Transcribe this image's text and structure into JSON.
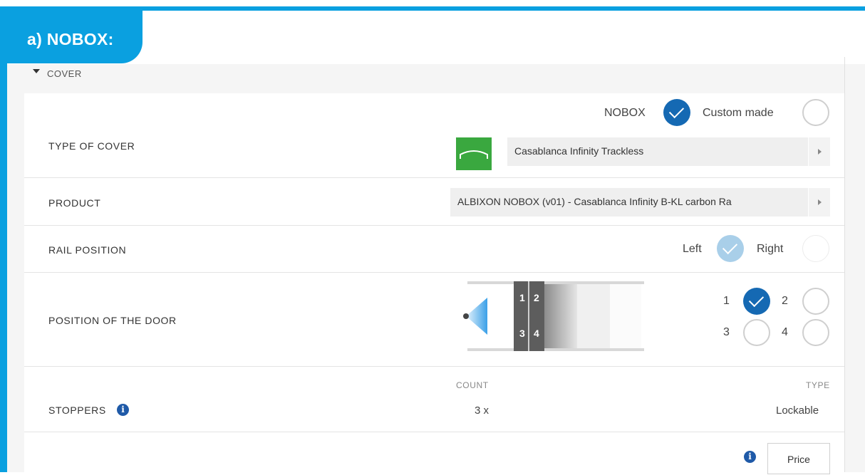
{
  "tab": {
    "title": "a) NOBOX:"
  },
  "section": {
    "title": "COVER"
  },
  "type_of_cover": {
    "label": "TYPE OF COVER",
    "options": [
      {
        "label": "NOBOX",
        "checked": true
      },
      {
        "label": "Custom made",
        "checked": false
      }
    ],
    "select_value": "Casablanca Infinity Trackless"
  },
  "product": {
    "label": "PRODUCT",
    "select_value": "ALBIXON NOBOX (v01) - Casablanca Infinity B-KL carbon Ra"
  },
  "rail_position": {
    "label": "RAIL POSITION",
    "options": [
      {
        "label": "Left",
        "checked": true
      },
      {
        "label": "Right",
        "checked": false
      }
    ]
  },
  "door_position": {
    "label": "POSITION OF THE DOOR",
    "diagram_numbers": [
      "1",
      "2",
      "3",
      "4"
    ],
    "options": [
      {
        "label": "1",
        "checked": true
      },
      {
        "label": "2",
        "checked": false
      },
      {
        "label": "3",
        "checked": false
      },
      {
        "label": "4",
        "checked": false
      }
    ]
  },
  "stoppers": {
    "label": "STOPPERS",
    "count_header": "COUNT",
    "type_header": "TYPE",
    "count_value": "3 x",
    "type_value": "Lockable"
  },
  "footer": {
    "price_label": "Price"
  },
  "icons": {
    "info": "info-icon",
    "section_toggle": "caret-down-icon",
    "checkmark": "checkmark-icon",
    "select_arrow": "chevron-right-icon"
  },
  "colors": {
    "accent": "#0aa0e0",
    "radio_checked": "#1569b3",
    "radio_light": "#a9cfe9",
    "cover_thumb": "#3aa83f"
  }
}
